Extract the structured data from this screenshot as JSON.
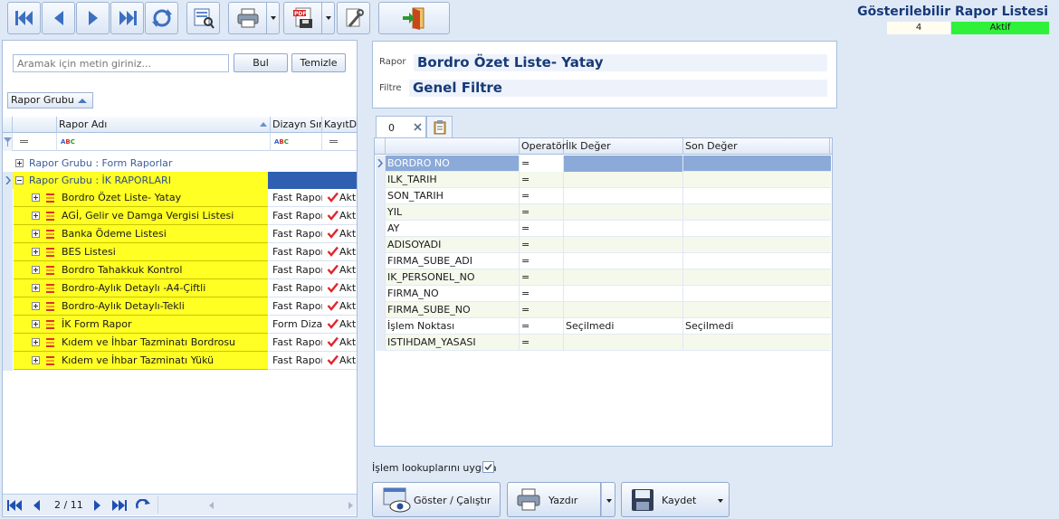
{
  "toolbar": {
    "icons": [
      "first-icon",
      "prev-icon",
      "next-icon",
      "last-icon",
      "refresh-icon",
      "preview-icon",
      "print-icon",
      "pdf-export-icon",
      "settings-icon",
      "exit-icon"
    ]
  },
  "report_list": {
    "title": "Gösterilebilir Rapor Listesi",
    "count": "4",
    "status": "Aktif",
    "status_color": "#2ff13a"
  },
  "search": {
    "placeholder": "Aramak için metin giriniz...",
    "find_label": "Bul",
    "clear_label": "Temizle"
  },
  "grouping": {
    "chip_label": "Rapor Grubu"
  },
  "left_grid": {
    "columns": [
      "Rapor Adı",
      "Dizayn Sınıfı",
      "KayıtDurumu"
    ],
    "groups": [
      {
        "label": "Rapor Grubu : Form Raporlar",
        "expanded": false
      },
      {
        "label": "Rapor Grubu : İK RAPORLARI",
        "expanded": true
      }
    ],
    "rows": [
      {
        "name": "Bordro Özet Liste- Yatay",
        "type": "Fast Rapor",
        "active": "Aktif"
      },
      {
        "name": "AGİ, Gelir ve Damga Vergisi Listesi",
        "type": "Fast Rapor",
        "active": "Aktif"
      },
      {
        "name": "Banka Ödeme Listesi",
        "type": "Fast Rapor",
        "active": "Aktif"
      },
      {
        "name": "BES Listesi",
        "type": "Fast Rapor",
        "active": "Aktif"
      },
      {
        "name": "Bordro Tahakkuk Kontrol",
        "type": "Fast Rapor",
        "active": "Aktif"
      },
      {
        "name": "Bordro-Aylık Detaylı -A4-Çiftli",
        "type": "Fast Rapor",
        "active": "Aktif"
      },
      {
        "name": "Bordro-Aylık Detaylı-Tekli",
        "type": "Fast Rapor",
        "active": "Aktif"
      },
      {
        "name": "İK Form Rapor",
        "type": "Form Dizayn",
        "active": "Aktif"
      },
      {
        "name": "Kıdem ve İhbar Tazminatı Bordrosu",
        "type": "Fast Rapor",
        "active": "Aktif"
      },
      {
        "name": "Kıdem ve İhbar Tazminatı Yükü",
        "type": "Fast Rapor",
        "active": "Aktif"
      }
    ],
    "highlight_color": "#ffff23"
  },
  "pager": {
    "text": "2 / 11"
  },
  "info": {
    "report_label": "Rapor",
    "report_value": "Bordro Özet Liste- Yatay",
    "filter_label": "Filtre",
    "filter_value": "Genel Filtre"
  },
  "tabs": {
    "active_label": "0"
  },
  "param_grid": {
    "columns": [
      "",
      "Operatör",
      "İlk Değer",
      "Son Değer"
    ],
    "rows": [
      {
        "name": "BORDRO NO",
        "op": "=",
        "first": "",
        "last": ""
      },
      {
        "name": "ILK_TARIH",
        "op": "=",
        "first": "",
        "last": ""
      },
      {
        "name": "SON_TARIH",
        "op": "=",
        "first": "",
        "last": ""
      },
      {
        "name": "YIL",
        "op": "=",
        "first": "",
        "last": ""
      },
      {
        "name": "AY",
        "op": "=",
        "first": "",
        "last": ""
      },
      {
        "name": "ADISOYADI",
        "op": "=",
        "first": "",
        "last": ""
      },
      {
        "name": "FIRMA_SUBE_ADI",
        "op": "=",
        "first": "",
        "last": ""
      },
      {
        "name": "IK_PERSONEL_NO",
        "op": "=",
        "first": "",
        "last": ""
      },
      {
        "name": "FIRMA_NO",
        "op": "=",
        "first": "",
        "last": ""
      },
      {
        "name": "FIRMA_SUBE_NO",
        "op": "=",
        "first": "",
        "last": ""
      },
      {
        "name": "İşlem Noktası",
        "op": "=",
        "first": "Seçilmedi",
        "last": "Seçilmedi"
      },
      {
        "name": "ISTIHDAM_YASASI",
        "op": "=",
        "first": "",
        "last": ""
      }
    ]
  },
  "footer": {
    "lookup_label": "İşlem lookuplarını uygula",
    "lookup_checked": true,
    "show_label": "Göster / Çalıştır",
    "print_label": "Yazdır",
    "save_label": "Kaydet"
  }
}
